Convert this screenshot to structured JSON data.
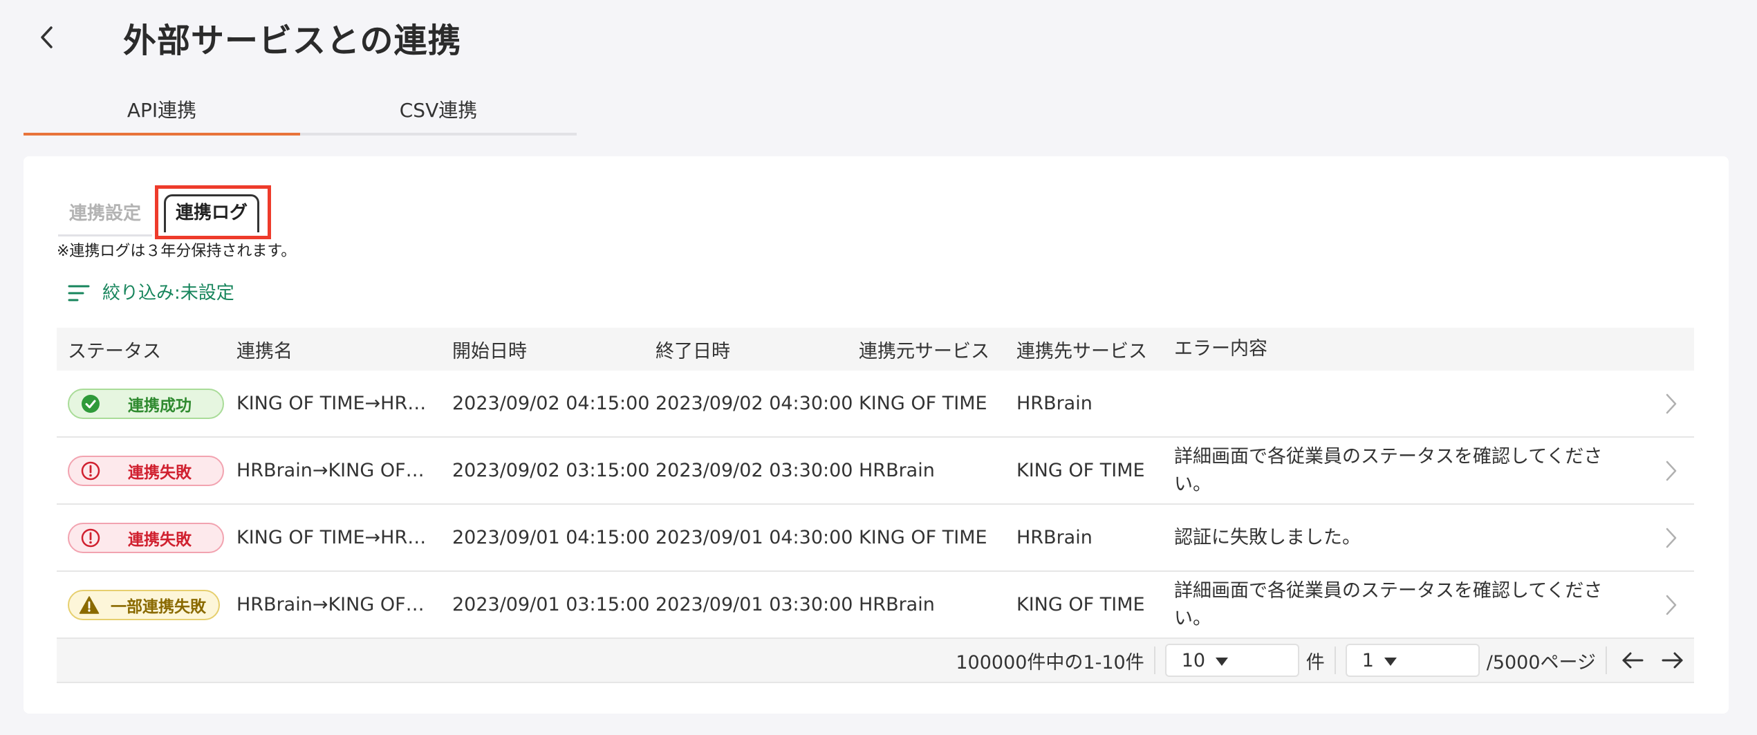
{
  "header": {
    "title": "外部サービスとの連携"
  },
  "main_tabs": [
    {
      "label": "API連携",
      "active": true
    },
    {
      "label": "CSV連携",
      "active": false
    }
  ],
  "sub_tabs": [
    {
      "label": "連携設定",
      "active": false
    },
    {
      "label": "連携ログ",
      "active": true
    }
  ],
  "note": "※連携ログは３年分保持されます。",
  "filter": {
    "label": "絞り込み:未設定"
  },
  "table": {
    "columns": [
      "ステータス",
      "連携名",
      "開始日時",
      "終了日時",
      "連携元サービス",
      "連携先サービス",
      "エラー内容"
    ],
    "rows": [
      {
        "status": "連携成功",
        "name": "KING OF TIME→HR…",
        "start": "2023/09/02 04:15:00",
        "end": "2023/09/02 04:30:00",
        "source": "KING OF TIME",
        "destination": "HRBrain",
        "error": ""
      },
      {
        "status": "連携失敗",
        "name": "HRBrain→KING OF…",
        "start": "2023/09/02 03:15:00",
        "end": "2023/09/02 03:30:00",
        "source": "HRBrain",
        "destination": "KING OF TIME",
        "error": "詳細画面で各従業員のステータスを確認してください。"
      },
      {
        "status": "連携失敗",
        "name": "KING OF TIME→HR…",
        "start": "2023/09/01 04:15:00",
        "end": "2023/09/01 04:30:00",
        "source": "KING OF TIME",
        "destination": "HRBrain",
        "error": "認証に失敗しました。"
      },
      {
        "status": "一部連携失敗",
        "name": "HRBrain→KING OF…",
        "start": "2023/09/01 03:15:00",
        "end": "2023/09/01 03:30:00",
        "source": "HRBrain",
        "destination": "KING OF TIME",
        "error": "詳細画面で各従業員のステータスを確認してください。"
      }
    ]
  },
  "pagination": {
    "summary": "100000件中の1-10件",
    "per_page": "10",
    "per_page_unit": "件",
    "page": "1",
    "page_total": "/5000ページ"
  },
  "colors": {
    "accent": "#e8743b",
    "filter": "#17855c",
    "highlight": "#ee3b2b"
  }
}
